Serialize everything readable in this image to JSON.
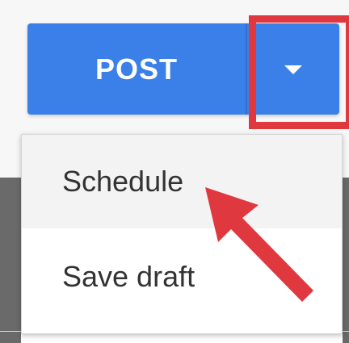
{
  "split_button": {
    "post_label": "POST",
    "toggle_icon": "caret-down-icon",
    "accent_color": "#3b80e8"
  },
  "dropdown_menu": {
    "items": [
      {
        "label": "Schedule",
        "highlighted": true
      },
      {
        "label": "Save draft",
        "highlighted": false
      }
    ]
  },
  "annotations": {
    "highlight_color": "#e0383f",
    "arrow_color": "#e0383f"
  }
}
